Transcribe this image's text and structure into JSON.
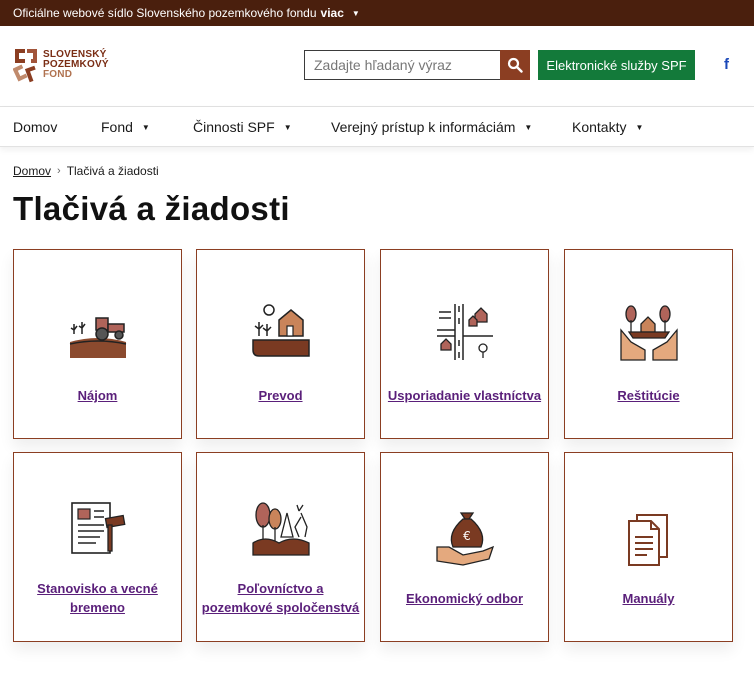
{
  "topbar": {
    "text": "Oficiálne webové sídlo Slovenského pozemkového fondu",
    "more": "viac"
  },
  "logo": {
    "line1": "SLOVENSKÝ",
    "line2": "POZEMKOVÝ",
    "line3": "FOND"
  },
  "search": {
    "placeholder": "Zadajte hľadaný výraz"
  },
  "header": {
    "eservices": "Elektronické služby SPF",
    "facebook": "f"
  },
  "nav": {
    "items": [
      {
        "label": "Domov"
      },
      {
        "label": "Fond"
      },
      {
        "label": "Činnosti SPF"
      },
      {
        "label": "Verejný prístup k informáciám"
      },
      {
        "label": "Kontakty"
      }
    ]
  },
  "breadcrumb": {
    "home": "Domov",
    "current": "Tlačivá a žiadosti"
  },
  "page": {
    "title": "Tlačivá a žiadosti"
  },
  "cards": [
    {
      "label": "Nájom",
      "icon": "tractor-field-icon"
    },
    {
      "label": "Prevod",
      "icon": "house-field-icon"
    },
    {
      "label": "Usporiadanie vlastníctva",
      "icon": "land-plot-map-icon"
    },
    {
      "label": "Reštitúcie",
      "icon": "hands-house-icon"
    },
    {
      "label": "Stanovisko a vecné bremeno",
      "icon": "document-gavel-icon"
    },
    {
      "label": "Poľovníctvo a pozemkové spoločenstvá",
      "icon": "forest-deer-icon"
    },
    {
      "label": "Ekonomický odbor",
      "icon": "hand-money-bag-icon"
    },
    {
      "label": "Manuály",
      "icon": "documents-icon"
    }
  ],
  "colors": {
    "topbar": "#4a1f0d",
    "accent": "#8b3e22",
    "green": "#137a3a",
    "link": "#5a1f7a"
  }
}
